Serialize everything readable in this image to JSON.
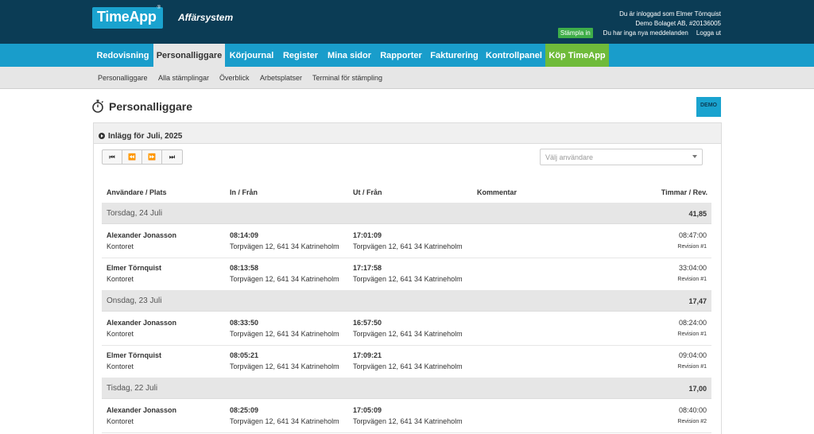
{
  "header": {
    "logo": "TimeApp",
    "logo_mark": "®",
    "subtitle": "Affärsystem",
    "logged_in_as": "Du är inloggad som Elmer Törnquist",
    "company": "Demo Bolaget AB, #20136005",
    "stampla_in": "Stämpla in",
    "no_messages": "Du har inga nya meddelanden",
    "logout": "Logga ut"
  },
  "mainnav": [
    {
      "label": "Redovisning"
    },
    {
      "label": "Personalliggare",
      "active": true
    },
    {
      "label": "Körjournal"
    },
    {
      "label": "Register"
    },
    {
      "label": "Mina sidor"
    },
    {
      "label": "Rapporter"
    },
    {
      "label": "Fakturering"
    },
    {
      "label": "Kontrollpanel"
    },
    {
      "label": "Köp TimeApp",
      "buy": true
    }
  ],
  "subnav": [
    {
      "label": "Personalliggare"
    },
    {
      "label": "Alla stämplingar"
    },
    {
      "label": "Överblick"
    },
    {
      "label": "Arbetsplatser"
    },
    {
      "label": "Terminal för stämpling"
    }
  ],
  "page": {
    "title": "Personalliggare",
    "demo_badge": "DEMO"
  },
  "panel": {
    "heading": "Inlägg för Juli, 2025",
    "pager": [
      "⏮",
      "⏪",
      "⏩",
      "⏭"
    ],
    "user_select_placeholder": "Välj användare",
    "columns": {
      "user": "Användare / Plats",
      "in": "In / Från",
      "out": "Ut / Från",
      "comment": "Kommentar",
      "hours": "Timmar / Rev."
    }
  },
  "days": [
    {
      "label": "Torsdag, 24 Juli",
      "total": "41,85",
      "entries": [
        {
          "user": "Alexander Jonasson",
          "place": "Kontoret",
          "in_time": "08:14:09",
          "in_addr": "Torpvägen 12, 641 34 Katrineholm",
          "out_time": "17:01:09",
          "out_addr": "Torpvägen 12, 641 34 Katrineholm",
          "hours": "08:47:00",
          "rev": "Revision #1"
        },
        {
          "user": "Elmer Törnquist",
          "place": "Kontoret",
          "in_time": "08:13:58",
          "in_addr": "Torpvägen 12, 641 34 Katrineholm",
          "out_time": "17:17:58",
          "out_addr": "Torpvägen 12, 641 34 Katrineholm",
          "hours": "33:04:00",
          "rev": "Revision #1"
        }
      ]
    },
    {
      "label": "Onsdag, 23 Juli",
      "total": "17,47",
      "entries": [
        {
          "user": "Alexander Jonasson",
          "place": "Kontoret",
          "in_time": "08:33:50",
          "in_addr": "Torpvägen 12, 641 34 Katrineholm",
          "out_time": "16:57:50",
          "out_addr": "Torpvägen 12, 641 34 Katrineholm",
          "hours": "08:24:00",
          "rev": "Revision #1"
        },
        {
          "user": "Elmer Törnquist",
          "place": "Kontoret",
          "in_time": "08:05:21",
          "in_addr": "Torpvägen 12, 641 34 Katrineholm",
          "out_time": "17:09:21",
          "out_addr": "Torpvägen 12, 641 34 Katrineholm",
          "hours": "09:04:00",
          "rev": "Revision #1"
        }
      ]
    },
    {
      "label": "Tisdag, 22 Juli",
      "total": "17,00",
      "entries": [
        {
          "user": "Alexander Jonasson",
          "place": "Kontoret",
          "in_time": "08:25:09",
          "in_addr": "Torpvägen 12, 641 34 Katrineholm",
          "out_time": "17:05:09",
          "out_addr": "Torpvägen 12, 641 34 Katrineholm",
          "hours": "08:40:00",
          "rev": "Revision #2"
        }
      ]
    }
  ]
}
